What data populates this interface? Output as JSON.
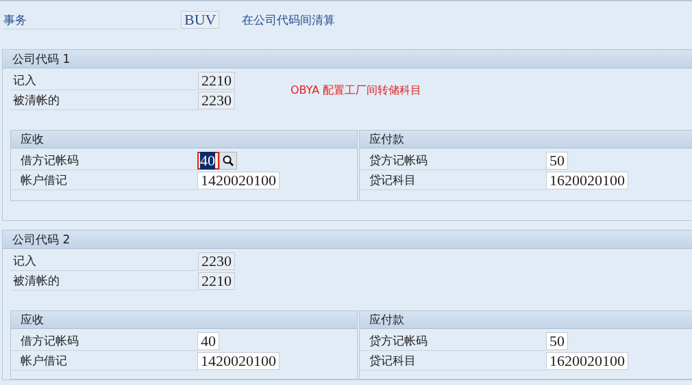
{
  "transaction": {
    "label": "事务",
    "code": "BUV",
    "description": "在公司代码间清算"
  },
  "company_codes": [
    {
      "title": "公司代码 1",
      "fields": [
        {
          "label": "记入",
          "value": "2210",
          "kind": "readonly"
        },
        {
          "label": "被清帐的",
          "value": "2230",
          "kind": "readonly"
        }
      ],
      "note": "OBYA 配置工厂间转储科目",
      "receivable": {
        "title": "应收",
        "fields": [
          {
            "label": "借方记帐码",
            "value": "40",
            "kind": "input",
            "focused": true
          },
          {
            "label": "帐户借记",
            "value": "1420020100",
            "kind": "input",
            "focused": false
          }
        ]
      },
      "payable": {
        "title": "应付款",
        "fields": [
          {
            "label": "贷方记帐码",
            "value": "50",
            "kind": "input",
            "focused": false
          },
          {
            "label": "贷记科目",
            "value": "1620020100",
            "kind": "input",
            "focused": false
          }
        ]
      }
    },
    {
      "title": "公司代码 2",
      "fields": [
        {
          "label": "记入",
          "value": "2230",
          "kind": "readonly"
        },
        {
          "label": "被清帐的",
          "value": "2210",
          "kind": "readonly"
        }
      ],
      "receivable": {
        "title": "应收",
        "fields": [
          {
            "label": "借方记帐码",
            "value": "40",
            "kind": "input",
            "focused": false
          },
          {
            "label": "帐户借记",
            "value": "1420020100",
            "kind": "input",
            "focused": false
          }
        ]
      },
      "payable": {
        "title": "应付款",
        "fields": [
          {
            "label": "贷方记帐码",
            "value": "50",
            "kind": "input",
            "focused": false
          },
          {
            "label": "贷记科目",
            "value": "1620020100",
            "kind": "input",
            "focused": false
          }
        ]
      }
    }
  ]
}
